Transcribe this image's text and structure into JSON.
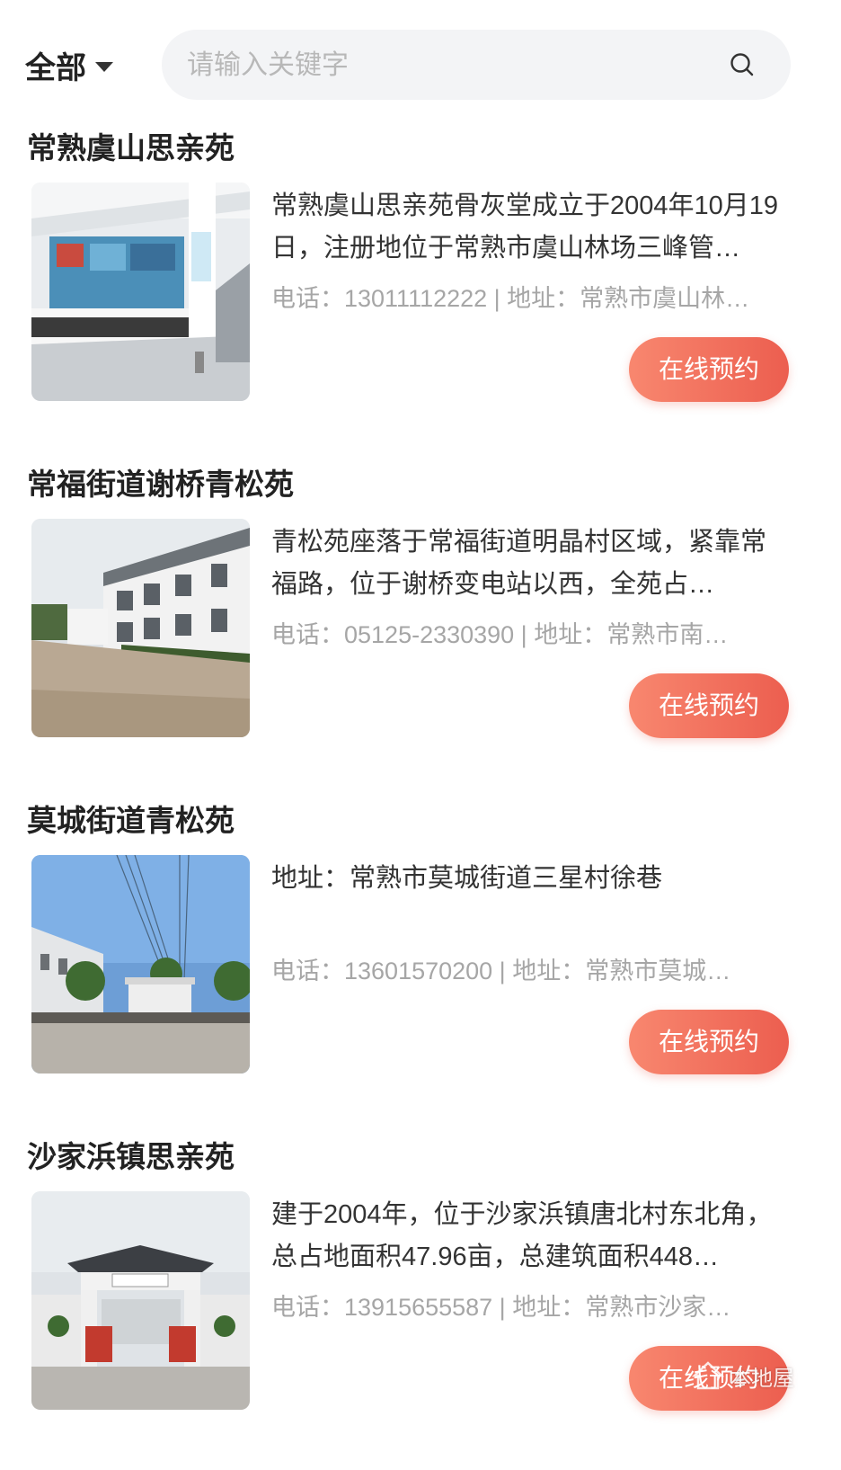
{
  "header": {
    "filter_label": "全部",
    "search_placeholder": "请输入关键字"
  },
  "cards": [
    {
      "title": "常熟虞山思亲苑",
      "description": "常熟虞山思亲苑骨灰堂成立于2004年10月19日，注册地位于常熟市虞山林场三峰管…",
      "meta": "电话：13011112222 | 地址：常熟市虞山林…",
      "button": "在线预约",
      "image": "service-hall-photo"
    },
    {
      "title": "常福街道谢桥青松苑",
      "description": "青松苑座落于常福街道明晶村区域，紧靠常福路，位于谢桥变电站以西，全苑占…",
      "meta": "电话：05125-2330390 | 地址：常熟市南…",
      "button": "在线预约",
      "image": "building-exterior-photo"
    },
    {
      "title": "莫城街道青松苑",
      "description": "地址：常熟市莫城街道三星村徐巷",
      "meta": "电话：13601570200 | 地址：常熟市莫城…",
      "button": "在线预约",
      "image": "gate-house-photo"
    },
    {
      "title": "沙家浜镇思亲苑",
      "description": "建于2004年，位于沙家浜镇唐北村东北角，总占地面积47.96亩，总建筑面积448…",
      "meta": "电话：13915655587 | 地址：常熟市沙家…",
      "button": "在线预约",
      "image": "entrance-gate-photo"
    }
  ],
  "watermark": {
    "text": "本地屋"
  },
  "colors": {
    "accent": "#ec5e4f",
    "search_bg": "#f3f4f6",
    "meta_text": "#a6a6a6"
  }
}
